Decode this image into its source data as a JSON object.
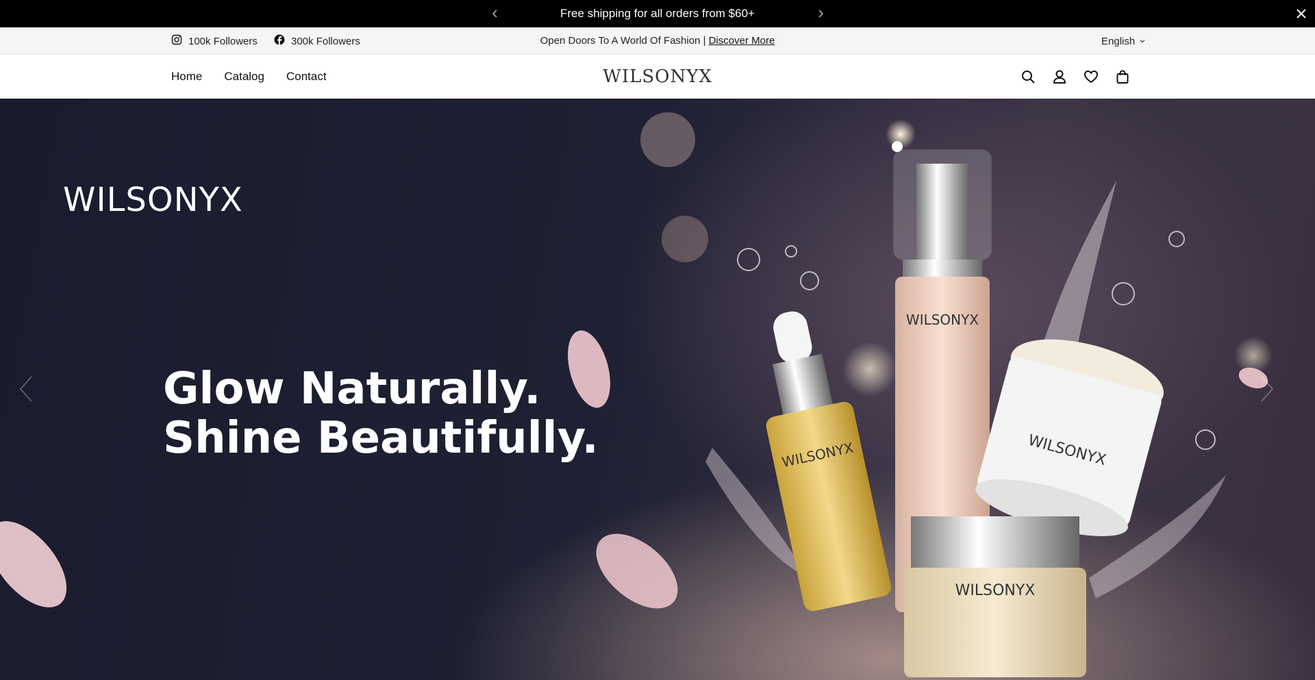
{
  "announcement": {
    "message": "Free shipping for all orders from $60+"
  },
  "topbar": {
    "instagram_followers": "100k Followers",
    "facebook_followers": "300k Followers",
    "promo_text": "Open Doors To A World Of Fashion |",
    "promo_link": "Discover More",
    "language": "English"
  },
  "header": {
    "nav": [
      "Home",
      "Catalog",
      "Contact"
    ],
    "logo": "WILSONYX",
    "icons": [
      "search-icon",
      "account-icon",
      "wishlist-icon",
      "cart-icon"
    ]
  },
  "hero": {
    "brand": "WILSONYX",
    "title_line1": "Glow Naturally.",
    "title_line2": "Shine Beautifully.",
    "product_labels": [
      "WILSONYX",
      "WILSONYX",
      "WILSONYX",
      "WILSONYX"
    ]
  },
  "colors": {
    "announcement_bg": "#000000",
    "topbar_bg": "#f5f5f5",
    "hero_bg": "#1e2033"
  }
}
